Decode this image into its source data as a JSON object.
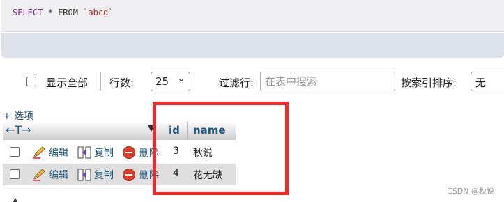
{
  "sql": {
    "keyword_select": "SELECT",
    "middle": " * ",
    "keyword_from": "FROM",
    "table": " `abcd`"
  },
  "toolbar": {
    "show_all_label": "显示全部",
    "rows_label": "行数:",
    "rows_value": "25",
    "filter_label": "过滤行:",
    "search_placeholder": "在表中搜索",
    "sort_label": "按索引排序:",
    "sort_value": "无"
  },
  "options_link": "+ 选项",
  "table": {
    "columns": [
      "id",
      "name"
    ],
    "actions": {
      "edit": "编辑",
      "copy": "复制",
      "delete": "删除"
    },
    "rows": [
      {
        "id": "3",
        "name": "秋说"
      },
      {
        "id": "4",
        "name": "花无缺"
      }
    ]
  },
  "watermark": "CSDN @秋说",
  "colors": {
    "link": "#235a81",
    "highlight": "#ee2a2a",
    "delete_icon": "#d9412b"
  },
  "icons": [
    "pencil-icon",
    "copy-icon",
    "delete-icon",
    "sort-desc-icon",
    "column-arrows-icon"
  ]
}
